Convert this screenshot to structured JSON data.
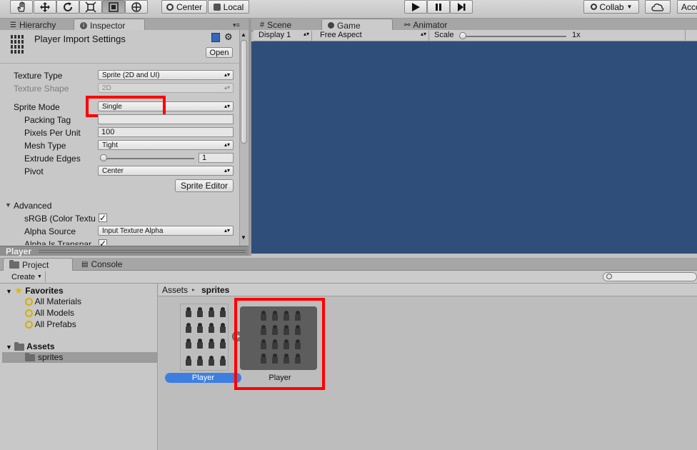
{
  "toolbar": {
    "center_label": "Center",
    "local_label": "Local",
    "collab_label": "Collab",
    "account_label": "Acco"
  },
  "left_tabs": {
    "hierarchy": "Hierarchy",
    "inspector": "Inspector"
  },
  "inspector": {
    "title": "Player Import Settings",
    "open_label": "Open",
    "texture_type": {
      "label": "Texture Type",
      "value": "Sprite (2D and UI)"
    },
    "texture_shape": {
      "label": "Texture Shape",
      "value": "2D"
    },
    "sprite_mode": {
      "label": "Sprite Mode",
      "value": "Single"
    },
    "packing_tag": {
      "label": "Packing Tag",
      "value": ""
    },
    "pixels_per_unit": {
      "label": "Pixels Per Unit",
      "value": "100"
    },
    "mesh_type": {
      "label": "Mesh Type",
      "value": "Tight"
    },
    "extrude_edges": {
      "label": "Extrude Edges",
      "value": "1",
      "level": 0
    },
    "pivot": {
      "label": "Pivot",
      "value": "Center"
    },
    "sprite_editor_label": "Sprite Editor",
    "advanced_label": "Advanced",
    "srgb_label": "sRGB (Color Textu",
    "alpha_source": {
      "label": "Alpha Source",
      "value": "Input Texture Alpha"
    },
    "alpha_transparency_label": "Alpha Is Transpar",
    "footer_label": "Player"
  },
  "center_tabs": {
    "scene": "Scene",
    "game": "Game",
    "animator": "Animator"
  },
  "gamebar": {
    "display": "Display 1",
    "aspect": "Free Aspect",
    "scale_label": "Scale",
    "scale_value": "1x"
  },
  "bottom_tabs": {
    "project": "Project",
    "console": "Console"
  },
  "project": {
    "create_label": "Create",
    "favorites_label": "Favorites",
    "favorites": [
      "All Materials",
      "All Models",
      "All Prefabs"
    ],
    "assets_label": "Assets",
    "assets_children": [
      "sprites"
    ],
    "breadcrumb": [
      "Assets",
      "sprites"
    ],
    "items": [
      "Player",
      "Player"
    ]
  },
  "colors": {
    "game_view": "#2f4f7a",
    "selection": "#3d7fe0",
    "highlight_box": "#ff0000"
  }
}
